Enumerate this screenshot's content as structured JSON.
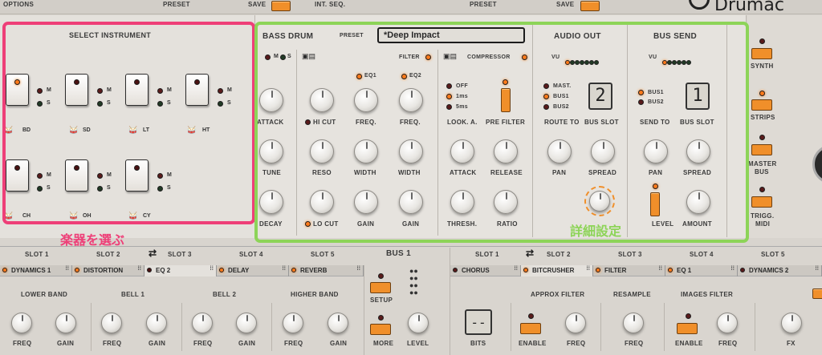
{
  "top": {
    "options": "OPTIONS",
    "preset1": "PRESET",
    "save1": "SAVE",
    "intseq": "INT. SEQ.",
    "preset2": "PRESET",
    "save2": "SAVE"
  },
  "instrument": {
    "title": "SELECT INSTRUMENT",
    "pads": [
      {
        "label": "BD"
      },
      {
        "label": "SD"
      },
      {
        "label": "LT"
      },
      {
        "label": "HT"
      },
      {
        "label": "CH"
      },
      {
        "label": "OH"
      },
      {
        "label": "CY"
      }
    ],
    "m": "M",
    "s": "S"
  },
  "bassdrum": {
    "title": "BASS DRUM",
    "preset_label": "PRESET",
    "preset_value": "*Deep Impact",
    "m": "M",
    "s": "S",
    "knobs": {
      "attack": "ATTACK",
      "tune": "TUNE",
      "decay": "DECAY"
    },
    "filter": {
      "title": "FILTER",
      "eq1": "EQ1",
      "eq2": "EQ2",
      "hicut": "HI CUT",
      "freq1": "FREQ.",
      "freq2": "FREQ.",
      "reso": "RESO",
      "width1": "WIDTH",
      "width2": "WIDTH",
      "locut": "LO CUT",
      "gain1": "GAIN",
      "gain2": "GAIN"
    }
  },
  "compressor": {
    "title": "COMPRESSOR",
    "look_options": [
      "OFF",
      "1ms",
      "5ms"
    ],
    "look_label": "LOOK. A.",
    "prefilter": "PRE FILTER",
    "attack": "ATTACK",
    "release": "RELEASE",
    "thresh": "THRESH.",
    "ratio": "RATIO"
  },
  "audioout": {
    "title": "AUDIO OUT",
    "vu": "VU",
    "routes": [
      "MAST.",
      "BUS1",
      "BUS2"
    ],
    "route_to": "ROUTE TO",
    "bus_slot": "BUS SLOT",
    "slot_value": "2",
    "pan": "PAN",
    "spread": "SPREAD"
  },
  "bussend": {
    "title": "BUS SEND",
    "vu": "VU",
    "routes": [
      "BUS1",
      "BUS2"
    ],
    "send_to": "SEND TO",
    "bus_slot": "BUS SLOT",
    "slot_value": "1",
    "pan": "PAN",
    "spread": "SPREAD",
    "level": "LEVEL",
    "amount": "AMOUNT"
  },
  "side": {
    "synth": "SYNTH",
    "strips": "STRIPS",
    "master1": "MASTER",
    "master2": "BUS",
    "trigg1": "TRIGG.",
    "trigg2": "MIDI"
  },
  "annotations": {
    "select": "楽器を選ぶ",
    "detail": "詳細設定",
    "accent_pink": "#ee3f78",
    "accent_green": "#8dd458"
  },
  "bus1": {
    "title": "BUS 1",
    "slots": [
      "SLOT 1",
      "SLOT 2",
      "SLOT 3",
      "SLOT 4",
      "SLOT 5"
    ],
    "tabs": [
      "DYNAMICS 1",
      "DISTORTION",
      "EQ 2",
      "DELAY",
      "REVERB"
    ],
    "bands": [
      "LOWER BAND",
      "BELL 1",
      "BELL 2",
      "HIGHER BAND"
    ],
    "freq": "FREQ",
    "gain": "GAIN",
    "setup": "SETUP",
    "more": "MORE",
    "level": "LEVEL"
  },
  "bus2": {
    "slots": [
      "SLOT 1",
      "SLOT 2",
      "SLOT 3",
      "SLOT 4",
      "SLOT 5"
    ],
    "tabs": [
      "CHORUS",
      "BITCRUSHER",
      "FILTER",
      "EQ 1",
      "DYNAMICS 2"
    ],
    "approx": "APPROX FILTER",
    "resample": "RESAMPLE",
    "images": "IMAGES FILTER",
    "bits": "BITS",
    "bits_value": "--",
    "enable": "ENABLE",
    "freq": "FREQ",
    "fx": "FX"
  }
}
